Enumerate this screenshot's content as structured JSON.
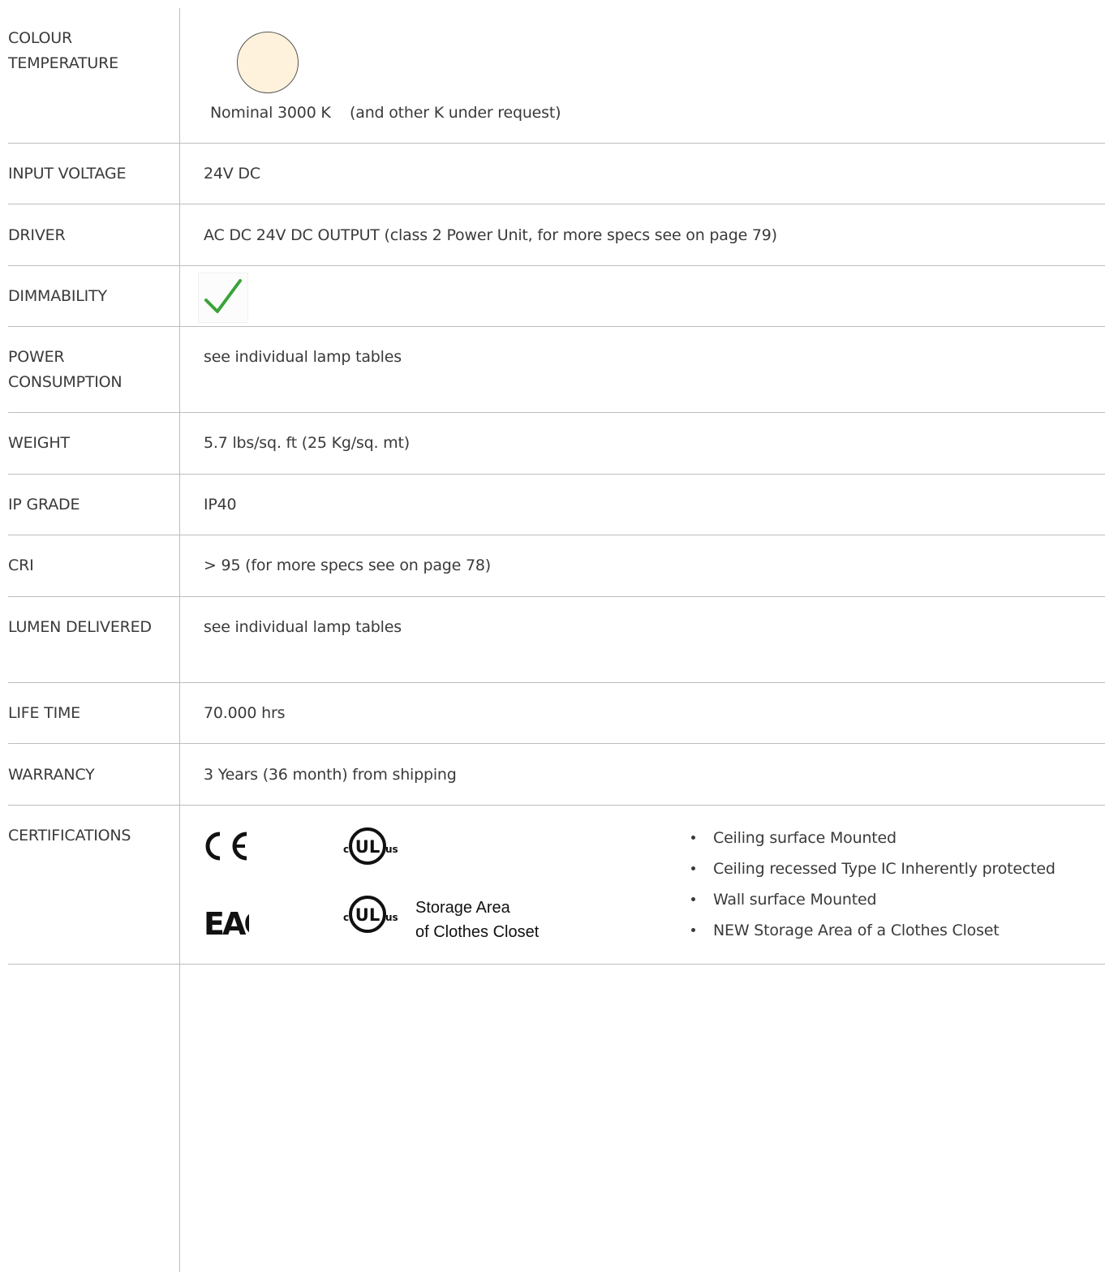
{
  "rows": [
    {
      "label": "COLOUR TEMPERATURE",
      "value": "Nominal 3000 K    (and other K under request)"
    },
    {
      "label": "INPUT VOLTAGE",
      "value": "24V DC"
    },
    {
      "label": "DRIVER",
      "value": "AC DC 24V DC OUTPUT (class 2 Power Unit, for more specs see on page 79)"
    },
    {
      "label": "DIMMABILITY",
      "value": ""
    },
    {
      "label": "POWER CONSUMPTION",
      "value": "see individual lamp tables"
    },
    {
      "label": "WEIGHT",
      "value": "5.7 lbs/sq. ft (25 Kg/sq. mt)"
    },
    {
      "label": "IP GRADE",
      "value": "IP40"
    },
    {
      "label": "CRI",
      "value": "> 95 (for more specs see on page 78)"
    },
    {
      "label": "LUMEN DELIVERED",
      "value": "see individual lamp tables"
    },
    {
      "label": "LIFE TIME",
      "value": "70.000 hrs"
    },
    {
      "label": "WARRANCY",
      "value": "3 Years (36 month) from shipping"
    },
    {
      "label": "CERTIFICATIONS",
      "value": ""
    }
  ],
  "colour_swatch": "#fff2dc",
  "dimmability_icon": "checkmark-icon",
  "check_color": "#3aa33a",
  "certifications": {
    "marks": [
      "CE",
      "cULus",
      "EAC",
      "cULus"
    ],
    "ul_storage_line1": "Storage Area",
    "ul_storage_line2": "of Clothes Closet",
    "bullets": [
      "Ceiling surface Mounted",
      "Ceiling recessed Type IC Inherently protected",
      "Wall surface Mounted",
      "NEW Storage Area of a Clothes Closet"
    ]
  }
}
